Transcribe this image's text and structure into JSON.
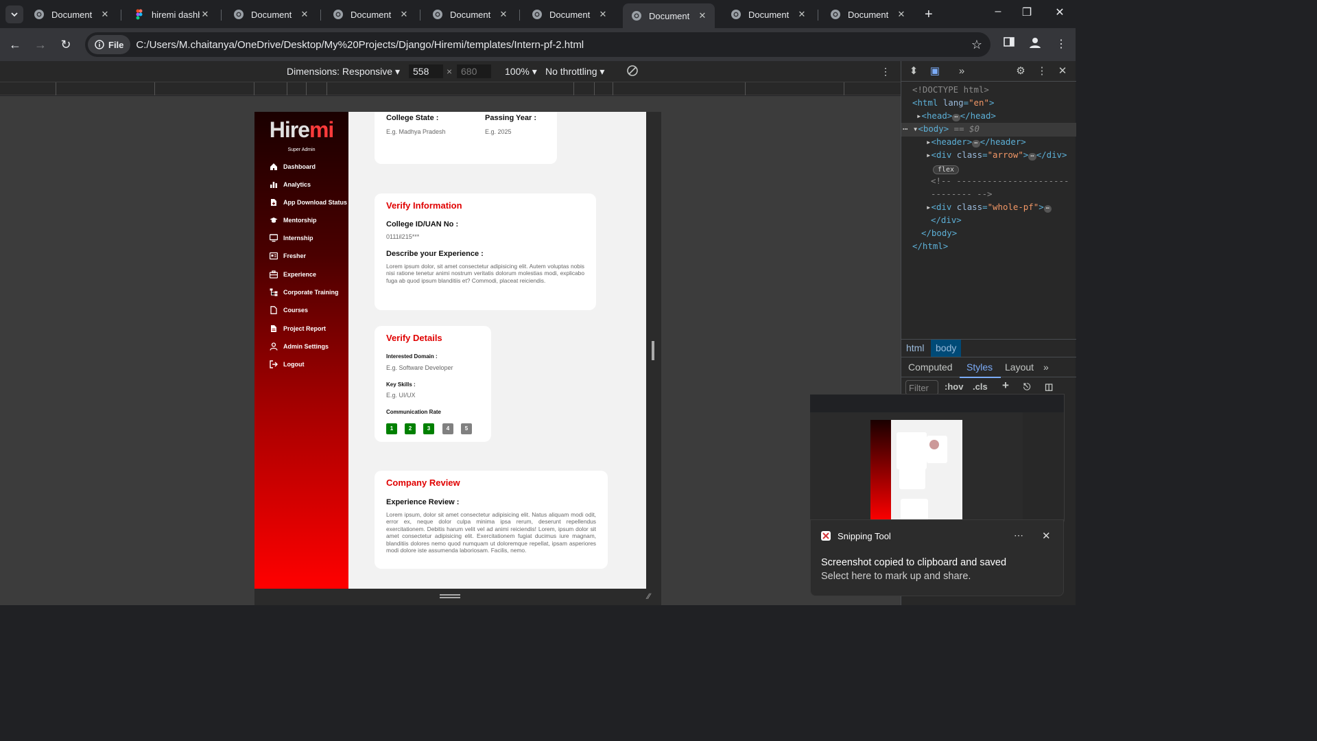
{
  "browser": {
    "tabs": [
      {
        "title": "Document",
        "icon": "globe-icon"
      },
      {
        "title": "hiremi dashb",
        "icon": "figma-icon"
      },
      {
        "title": "Document",
        "icon": "globe-icon"
      },
      {
        "title": "Document",
        "icon": "globe-icon"
      },
      {
        "title": "Document",
        "icon": "globe-icon"
      },
      {
        "title": "Document",
        "icon": "globe-icon"
      },
      {
        "title": "Document",
        "icon": "globe-icon",
        "active": true
      },
      {
        "title": "Document",
        "icon": "globe-icon"
      },
      {
        "title": "Document",
        "icon": "globe-icon"
      }
    ],
    "file_chip": "File",
    "url": "C:/Users/M.chaitanya/OneDrive/Desktop/My%20Projects/Django/Hiremi/templates/Intern-pf-2.html"
  },
  "device_toolbar": {
    "dimensions_label": "Dimensions: Responsive",
    "width": "558",
    "height": "680",
    "zoom": "100%",
    "throttling": "No throttling"
  },
  "app": {
    "logo_hi": "Hire",
    "logo_mi": "mi",
    "role": "Super Admin",
    "menu": [
      {
        "label": "Dashboard",
        "icon": "home-icon"
      },
      {
        "label": "Analytics",
        "icon": "bar-chart-icon"
      },
      {
        "label": "App Download Status",
        "icon": "file-download-icon"
      },
      {
        "label": "Mentorship",
        "icon": "graduation-cap-icon"
      },
      {
        "label": "Internship",
        "icon": "monitor-icon"
      },
      {
        "label": "Fresher",
        "icon": "id-card-icon"
      },
      {
        "label": "Experience",
        "icon": "briefcase-icon"
      },
      {
        "label": "Corporate Training",
        "icon": "sitemap-icon"
      },
      {
        "label": "Courses",
        "icon": "file-icon"
      },
      {
        "label": "Project Report",
        "icon": "report-icon"
      },
      {
        "label": "Admin Settings",
        "icon": "user-icon"
      },
      {
        "label": "Logout",
        "icon": "logout-icon"
      }
    ],
    "college_card": {
      "state_label": "College State :",
      "state_value": "E.g. Madhya Pradesh",
      "year_label": "Passing Year :",
      "year_value": "E.g. 2025"
    },
    "verify_info": {
      "title": "Verify Information",
      "id_label": "College ID/UAN No :",
      "id_value": "0111il215***",
      "exp_label": "Describe your Experience :",
      "exp_text": "Lorem ipsum dolor, sit amet consectetur adipisicing elit. Autem voluptas nobis nisi ratione tenetur animi nostrum veritatis dolorum molestias modi, explicabo fuga ab quod ipsum blanditiis et? Commodi, placeat reiciendis."
    },
    "verify_details": {
      "title": "Verify Details",
      "domain_label": "Interested Domain :",
      "domain_value": "E.g. Software Developer",
      "skills_label": "Key Skills :",
      "skills_value": "E.g. UI/UX",
      "comm_label": "Communication Rate",
      "rates": [
        "1",
        "2",
        "3",
        "4",
        "5"
      ],
      "rate_selected": 3,
      "color_on": "#008000",
      "color_off": "#808080"
    },
    "company_review": {
      "title": "Company Review",
      "exp_label": "Experience Review :",
      "exp_text": "Lorem ipsum, dolor sit amet consectetur adipisicing elit. Natus aliquam modi odit, error ex, neque dolor culpa minima ipsa rerum, deserunt repellendus exercitationem. Debitis harum velit vel ad animi reiciendis! Lorem, ipsum dolor sit amet consectetur adipisicing elit. Exercitationem fugiat ducimus iure magnam, blanditiis dolores nemo quod numquam ut doloremque repellat, ipsam asperiores modi dolore iste assumenda laboriosam. Facilis, nemo."
    }
  },
  "devtools": {
    "dom": {
      "doctype": "<!DOCTYPE html>",
      "html_open": "html",
      "lang_attr": "lang",
      "lang_val": "\"en\"",
      "head": "head",
      "body": "body",
      "dollar0": "== $0",
      "header": "header",
      "div": "div",
      "class_attr": "class",
      "arrow_val": "\"arrow\"",
      "flex_badge": "flex",
      "comment1": "<!-- ----------------------",
      "comment2": "-------- -->",
      "whole_val": "\"whole-pf\"",
      "div_close": "</div>",
      "body_close": "</body>",
      "html_close": "</html>"
    },
    "breadcrumbs": [
      "html",
      "body"
    ],
    "tabs": [
      "Computed",
      "Styles",
      "Layout"
    ],
    "filter_placeholder": "Filter",
    "hov": ":hov",
    "cls": ".cls"
  },
  "snipping_tool": {
    "app_name": "Snipping Tool",
    "message": "Screenshot copied to clipboard and saved",
    "sub_message": "Select here to mark up and share."
  }
}
